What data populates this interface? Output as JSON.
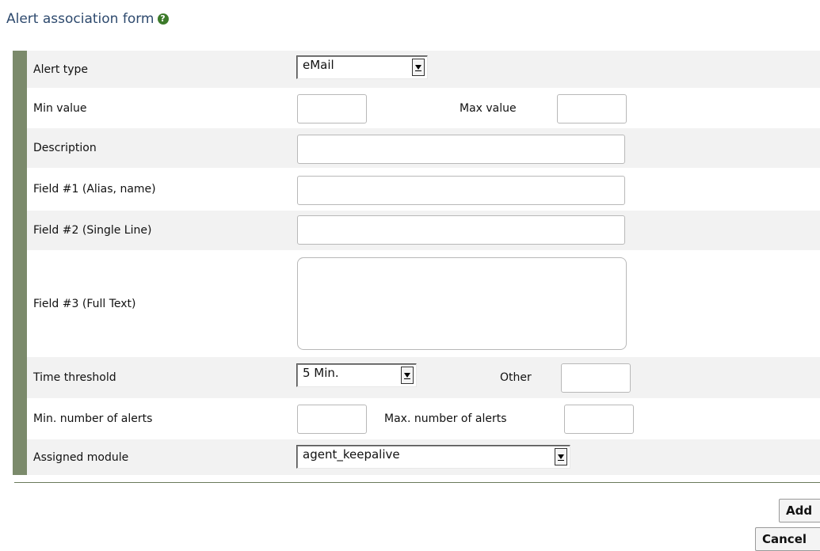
{
  "form": {
    "title": "Alert association form",
    "help_icon": "?"
  },
  "fields": {
    "alert_type": {
      "label": "Alert type",
      "value": "eMail"
    },
    "min_value": {
      "label": "Min value",
      "value": ""
    },
    "max_value": {
      "label": "Max value",
      "value": ""
    },
    "description": {
      "label": "Description",
      "value": ""
    },
    "field1": {
      "label": "Field #1 (Alias, name)",
      "value": ""
    },
    "field2": {
      "label": "Field #2 (Single Line)",
      "value": ""
    },
    "field3": {
      "label": "Field #3 (Full Text)",
      "value": ""
    },
    "time_threshold": {
      "label": "Time threshold",
      "value": "5 Min."
    },
    "other": {
      "label": "Other",
      "value": ""
    },
    "min_alerts": {
      "label": "Min. number of alerts",
      "value": ""
    },
    "max_alerts": {
      "label": "Max. number of alerts",
      "value": ""
    },
    "assigned_module": {
      "label": "Assigned module",
      "value": "agent_keepalive"
    }
  },
  "buttons": {
    "add": "Add",
    "cancel": "Cancel"
  },
  "colors": {
    "title": "#2e4a6e",
    "side_bar": "#7b8a6b",
    "row_alt": "#f2f2f2"
  }
}
